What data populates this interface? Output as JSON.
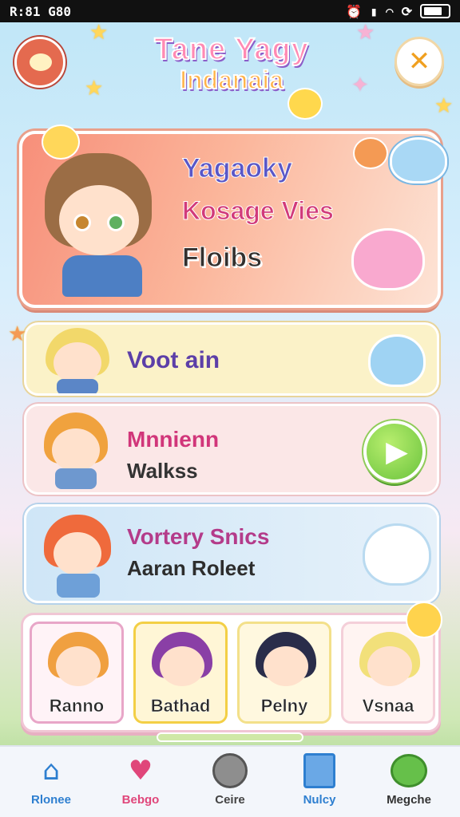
{
  "status_bar": {
    "time": "R:81 G80"
  },
  "title": {
    "line1": "Tane Yagy",
    "line2": "Indanaia"
  },
  "close_button": {
    "glyph": "✕"
  },
  "hero": {
    "line1": "Yagaoky",
    "line2": "Kosage Vies",
    "line3": "Floibs"
  },
  "rows": [
    {
      "title": "Voot ain",
      "subtitle": ""
    },
    {
      "title": "Mnnienn",
      "subtitle": "Walkss"
    },
    {
      "title": "Vortery Snics",
      "subtitle": "Aaran Roleet"
    }
  ],
  "characters": [
    {
      "name": "Ranno",
      "border": "#e8a6c8",
      "bg": "#fff3f7",
      "hair": "#f0a040"
    },
    {
      "name": "Bathad",
      "border": "#f3cf45",
      "bg": "#fff6d6",
      "hair": "#8a3fa6"
    },
    {
      "name": "Pelny",
      "border": "#f3e08a",
      "bg": "#fff8df",
      "hair": "#2a2d4a"
    },
    {
      "name": "Vsnaa",
      "border": "#f4cfd9",
      "bg": "#fff4f2",
      "hair": "#f2e07a"
    }
  ],
  "nav": [
    {
      "label": "Rlonee",
      "icon": "home-icon",
      "color": "#2e7fd0"
    },
    {
      "label": "Bebgo",
      "icon": "heart-icon",
      "color": "#e0467a"
    },
    {
      "label": "Ceire",
      "icon": "moon-icon",
      "color": "#444"
    },
    {
      "label": "Nulcy",
      "icon": "notebook-icon",
      "color": "#2e7fd0"
    },
    {
      "label": "Megche",
      "icon": "chat-bubble-icon",
      "color": "#333"
    }
  ],
  "colors": {
    "accent": "#ff8ab3",
    "hero_bg": "#f78f7a",
    "play": "#6ac33d"
  }
}
